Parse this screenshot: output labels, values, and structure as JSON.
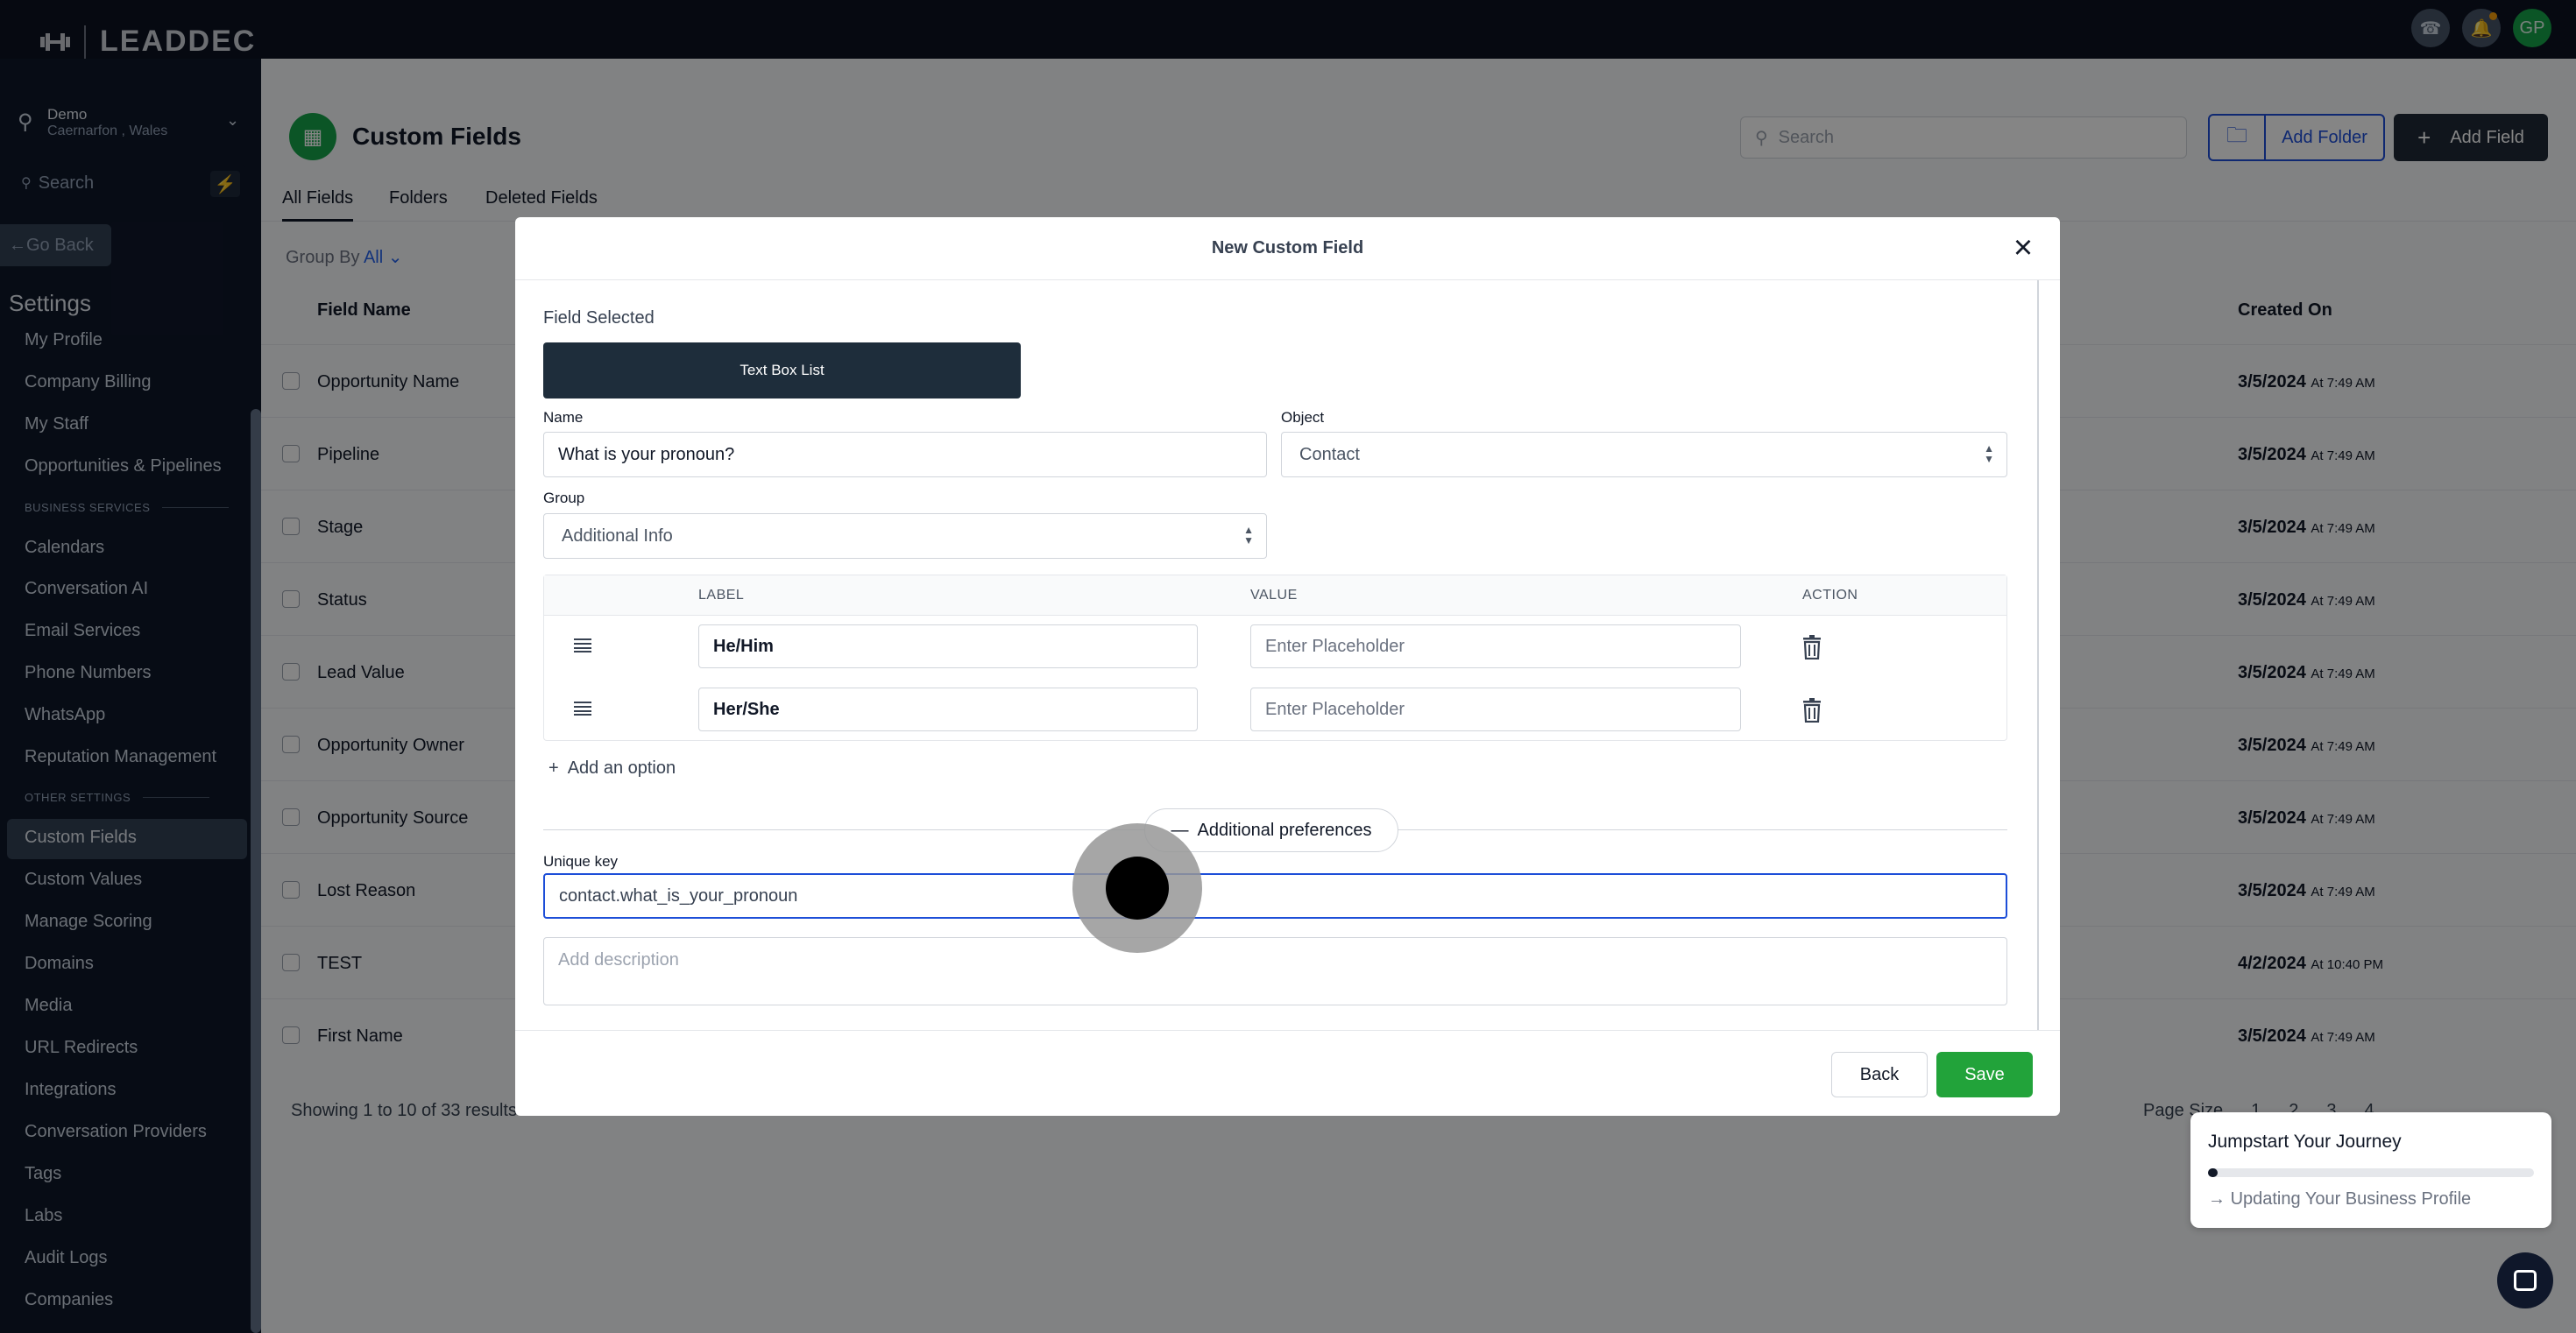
{
  "brand": {
    "logo_text": "LEADDEC"
  },
  "topbar": {
    "avatar_initials": "GP"
  },
  "sidebar": {
    "location_name": "Demo",
    "location_sub": "Caernarfon , Wales",
    "search_placeholder": "Search",
    "go_back": "Go Back",
    "settings_title": "Settings",
    "items": [
      {
        "label": "My Profile"
      },
      {
        "label": "Company Billing"
      },
      {
        "label": "My Staff"
      },
      {
        "label": "Opportunities & Pipelines"
      },
      {
        "label": "Calendars"
      },
      {
        "label": "Conversation AI"
      },
      {
        "label": "Email Services"
      },
      {
        "label": "Phone Numbers"
      },
      {
        "label": "WhatsApp"
      },
      {
        "label": "Reputation Management"
      },
      {
        "label": "Custom Fields"
      },
      {
        "label": "Custom Values"
      },
      {
        "label": "Manage Scoring"
      },
      {
        "label": "Domains"
      },
      {
        "label": "Media"
      },
      {
        "label": "URL Redirects"
      },
      {
        "label": "Integrations"
      },
      {
        "label": "Conversation Providers"
      },
      {
        "label": "Tags"
      },
      {
        "label": "Labs"
      },
      {
        "label": "Audit Logs"
      },
      {
        "label": "Companies"
      }
    ],
    "section_business": "BUSINESS SERVICES",
    "section_other": "OTHER SETTINGS"
  },
  "page": {
    "title": "Custom Fields",
    "search_placeholder": "Search",
    "add_folder": "Add Folder",
    "add_field": "Add Field",
    "tabs": [
      "All Fields",
      "Folders",
      "Deleted Fields"
    ],
    "group_by_label": "Group By",
    "group_by_value": "All",
    "columns": {
      "name": "Field Name",
      "created": "Created On"
    },
    "rows": [
      {
        "name": "Opportunity Name",
        "date": "3/5/2024",
        "time": "At 7:49 AM"
      },
      {
        "name": "Pipeline",
        "date": "3/5/2024",
        "time": "At 7:49 AM"
      },
      {
        "name": "Stage",
        "date": "3/5/2024",
        "time": "At 7:49 AM"
      },
      {
        "name": "Status",
        "date": "3/5/2024",
        "time": "At 7:49 AM"
      },
      {
        "name": "Lead Value",
        "date": "3/5/2024",
        "time": "At 7:49 AM"
      },
      {
        "name": "Opportunity Owner",
        "date": "3/5/2024",
        "time": "At 7:49 AM"
      },
      {
        "name": "Opportunity Source",
        "date": "3/5/2024",
        "time": "At 7:49 AM"
      },
      {
        "name": "Lost Reason",
        "date": "3/5/2024",
        "time": "At 7:49 AM"
      },
      {
        "name": "TEST",
        "date": "4/2/2024",
        "time": "At 10:40 PM"
      },
      {
        "name": "First Name",
        "date": "3/5/2024",
        "time": "At 7:49 AM"
      }
    ],
    "showing_text": "Showing 1 to 10 of 33 results",
    "page_size_label": "Page Size",
    "pages": [
      "1",
      "2",
      "3",
      "4"
    ]
  },
  "modal": {
    "title": "New Custom Field",
    "field_selected_label": "Field Selected",
    "field_type": "Text Box List",
    "name_label": "Name",
    "name_value": "What is your pronoun?",
    "object_label": "Object",
    "object_value": "Contact",
    "group_label": "Group",
    "group_value": "Additional Info",
    "table_headers": {
      "label": "LABEL",
      "value": "VALUE",
      "action": "ACTION"
    },
    "options": [
      {
        "label": "He/Him",
        "value_placeholder": "Enter Placeholder"
      },
      {
        "label": "Her/She",
        "value_placeholder": "Enter Placeholder"
      }
    ],
    "add_option": "Add an option",
    "additional_prefs": "Additional preferences",
    "unique_key_label": "Unique key",
    "unique_key_value": "contact.what_is_your_pronoun",
    "description_placeholder": "Add description",
    "back_button": "Back",
    "save_button": "Save"
  },
  "journey": {
    "title": "Jumpstart Your Journey",
    "step": "Updating Your Business Profile",
    "progress": 0.03
  },
  "colors": {
    "accent_blue": "#1d4ed8",
    "save_green": "#22a33a",
    "sidebar_bg": "#0f172a"
  }
}
